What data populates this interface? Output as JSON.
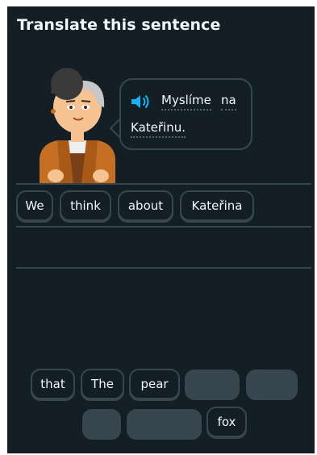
{
  "title": "Translate this sentence",
  "prompt": {
    "words": [
      "Myslíme",
      "na",
      "Kateřinu."
    ]
  },
  "answer": {
    "tiles": [
      "We",
      "think",
      "about",
      "Kateřina"
    ]
  },
  "bank": {
    "tiles": [
      "that",
      "The",
      "pear",
      "fox"
    ]
  },
  "icons": {
    "speaker": "speaker-icon"
  },
  "colors": {
    "background": "#131f24",
    "border": "#37464f",
    "text": "#f1f7fb",
    "speaker": "#1cb0f6"
  }
}
